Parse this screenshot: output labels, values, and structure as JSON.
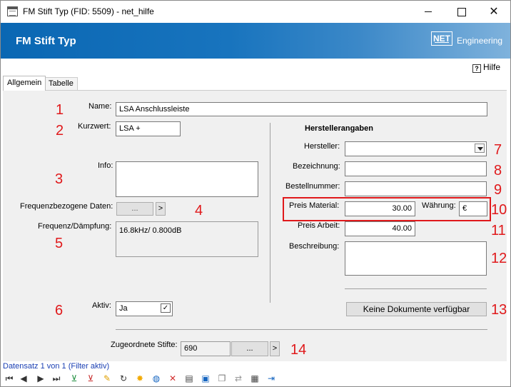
{
  "window": {
    "title": "FM Stift Typ (FID: 5509) - net_hilfe"
  },
  "banner": {
    "title": "FM Stift Typ",
    "logo_box": "NET",
    "logo_text": "Engineering"
  },
  "help": {
    "label": "Hilfe"
  },
  "tabs": [
    {
      "label": "Allgemein",
      "active": true
    },
    {
      "label": "Tabelle",
      "active": false
    }
  ],
  "form": {
    "name_label": "Name:",
    "name_value": "LSA Anschlussleiste",
    "kurzwert_label": "Kurzwert:",
    "kurzwert_value": "LSA +",
    "info_label": "Info:",
    "info_value": "",
    "freq_data_label": "Frequenzbezogene Daten:",
    "freq_data_button": "...",
    "freq_data_arrow": ">",
    "freq_daempfung_label": "Frequenz/Dämpfung:",
    "freq_daempfung_value": "16.8kHz/ 0.800dB",
    "aktiv_label": "Aktiv:",
    "aktiv_value": "Ja",
    "aktiv_check": "✓",
    "zugeordnete_label": "Zugeordnete Stifte:",
    "zugeordnete_value": "690",
    "zugeordnete_button": "...",
    "zugeordnete_arrow": ">"
  },
  "hersteller": {
    "section_title": "Herstellerangaben",
    "hersteller_label": "Hersteller:",
    "hersteller_value": "",
    "bezeichnung_label": "Bezeichnung:",
    "bezeichnung_value": "",
    "bestellnummer_label": "Bestellnummer:",
    "bestellnummer_value": "",
    "preis_material_label": "Preis Material:",
    "preis_material_value": "30.00",
    "waehrung_label": "Währung:",
    "waehrung_value": "€",
    "preis_arbeit_label": "Preis Arbeit:",
    "preis_arbeit_value": "40.00",
    "beschreibung_label": "Beschreibung:",
    "beschreibung_value": "",
    "dokumente_button": "Keine Dokumente verfügbar"
  },
  "annotations": [
    "1",
    "2",
    "3",
    "4",
    "5",
    "6",
    "7",
    "8",
    "9",
    "10",
    "11",
    "12",
    "13",
    "14"
  ],
  "status": {
    "text": "Datensatz 1 von 1 (Filter aktiv)"
  },
  "colors": {
    "accent": "#0a67b3",
    "annotation": "#e0191b",
    "status": "#1a3fb3"
  },
  "toolbar_icons": [
    "first-record-icon",
    "previous-record-icon",
    "next-record-icon",
    "last-record-icon",
    "add-filter-icon",
    "remove-filter-icon",
    "edit-icon",
    "refresh-icon",
    "highlight-icon",
    "globe-icon",
    "delete-icon",
    "print-icon",
    "select-icon",
    "copy-icon",
    "transfer-icon",
    "table-edit-icon",
    "exit-icon"
  ]
}
